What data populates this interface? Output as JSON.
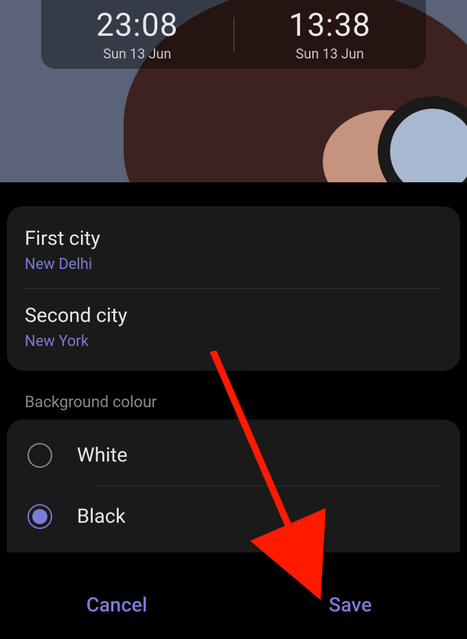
{
  "preview": {
    "clock1": {
      "time": "23:08",
      "date": "Sun 13 Jun"
    },
    "clock2": {
      "time": "13:38",
      "date": "Sun 13 Jun"
    }
  },
  "settings": {
    "city1": {
      "label": "First city",
      "value": "New Delhi"
    },
    "city2": {
      "label": "Second city",
      "value": "New York"
    }
  },
  "background": {
    "sectionLabel": "Background colour",
    "options": [
      {
        "label": "White",
        "selected": false
      },
      {
        "label": "Black",
        "selected": true
      }
    ]
  },
  "buttons": {
    "cancel": "Cancel",
    "save": "Save"
  },
  "colors": {
    "accent": "#7b7bd9",
    "text": "#e8e8e8",
    "muted": "#888888",
    "card": "#1a1a1a"
  }
}
